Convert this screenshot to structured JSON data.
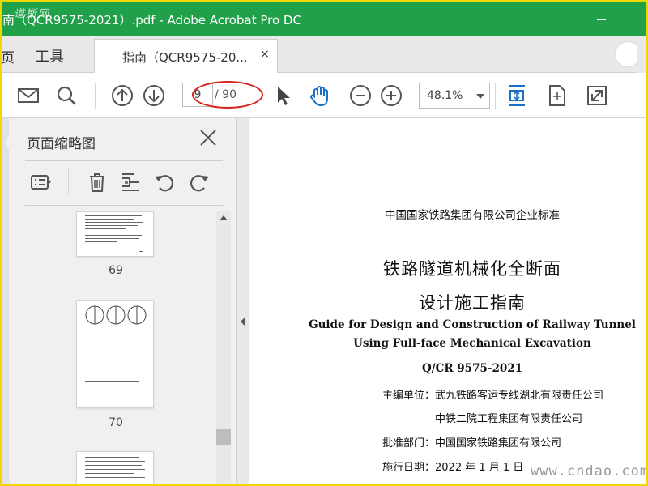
{
  "window": {
    "title": "南（QCR9575-2021）.pdf - Adobe Acrobat Pro DC",
    "watermark": "道斯网"
  },
  "tabs": {
    "home": "页",
    "tools": "工具",
    "document": "指南（QCR9575-20...",
    "close": "×"
  },
  "toolbar": {
    "page_current": "9",
    "page_total": "/ 90",
    "zoom": "48.1%"
  },
  "sidebar": {
    "title": "页面缩略图",
    "thumbnails": [
      {
        "page": "69"
      },
      {
        "page": "70"
      }
    ]
  },
  "document": {
    "org": "中国国家铁路集团有限公司企业标准",
    "title_cn_1": "铁路隧道机械化全断面",
    "title_cn_2": "设计施工指南",
    "title_en_1": "Guide for Design and Construction of Railway Tunnel",
    "title_en_2": "Using Full-face Mechanical Excavation",
    "code": "Q/CR 9575-2021",
    "editor_label": "主编单位：",
    "editor_1": "武九铁路客运专线湖北有限责任公司",
    "editor_2": "中铁二院工程集团有限责任公司",
    "approver_label": "批准部门：",
    "approver": "中国国家铁路集团有限公司",
    "effective_label": "施行日期：",
    "effective_date": "2022 年 1 月 1 日"
  },
  "watermark_site": "www.cndao.com",
  "colors": {
    "titlebar": "#21a04a",
    "accent_blue": "#1a6fc7",
    "annotation_red": "#d9211a",
    "outer_border": "#f1d700"
  }
}
